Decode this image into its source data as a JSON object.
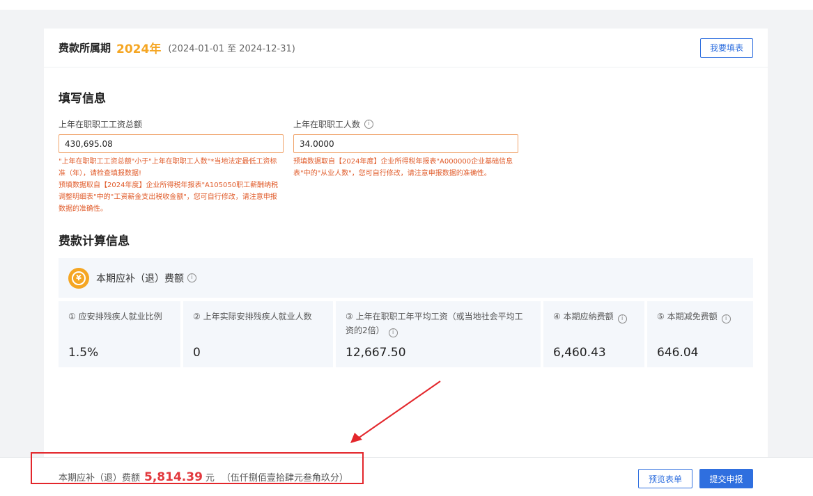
{
  "header": {
    "period_label": "费款所属期",
    "period_year": "2024年",
    "period_range": "(2024-01-01 至 2024-12-31)",
    "fill_button": "我要填表"
  },
  "fill_section": {
    "title": "填写信息",
    "fields": [
      {
        "label": "上年在职职工工资总额",
        "value": "430,695.08",
        "messages": [
          "\"上年在职职工工资总额\"小于\"上年在职职工人数\"*当地法定最低工资标准（年），请检查填报数据!",
          "预填数据取自【2024年度】企业所得税年报表\"A105050职工薪酬纳税调整明细表\"中的\"工资薪金支出税收金额\"，您可自行修改，请注意申报数据的准确性。"
        ]
      },
      {
        "label": "上年在职职工人数",
        "value": "34.0000",
        "messages": [
          "预填数据取自【2024年度】企业所得税年报表\"A000000企业基础信息表\"中的\"从业人数\"，您可自行修改，请注意申报数据的准确性。"
        ]
      }
    ]
  },
  "calc_section": {
    "title": "费款计算信息",
    "summary_title": "本期应补（退）费额",
    "metrics": [
      {
        "label": "① 应安排残疾人就业比例",
        "value": "1.5%"
      },
      {
        "label": "② 上年实际安排残疾人就业人数",
        "value": "0"
      },
      {
        "label": "③ 上年在职职工年平均工资（或当地社会平均工资的2倍）",
        "value": "12,667.50"
      },
      {
        "label": "④ 本期应纳费额",
        "value": "6,460.43"
      },
      {
        "label": "⑤ 本期减免费额",
        "value": "646.04"
      }
    ]
  },
  "bottom_bar": {
    "label": "本期应补（退）费额",
    "amount": "5,814.39",
    "unit": "元",
    "amount_words": "（伍仟捌佰壹拾肆元叁角玖分）",
    "preview_button": "预览表单",
    "submit_button": "提交申报"
  },
  "colors": {
    "accent": "#2f6fdf",
    "year": "#f5a623",
    "warning_text": "#e05b2a",
    "amount": "#e2383d",
    "annotation": "#e3262b"
  }
}
